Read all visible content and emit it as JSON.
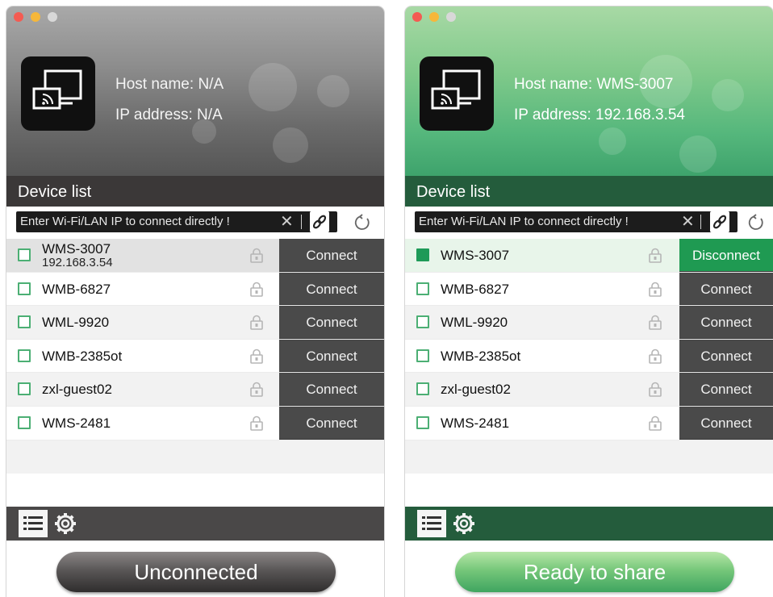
{
  "windows": [
    {
      "id": "left",
      "theme": "gray",
      "host_label": "Host name:",
      "host_value": "N/A",
      "ip_label": "IP address:",
      "ip_value": "N/A",
      "device_list_title": "Device list",
      "ip_placeholder": "Enter Wi-Fi/LAN IP to connect directly !",
      "devices": [
        {
          "name": "WMS-3007",
          "ip": "192.168.3.54",
          "checked": false,
          "button": "Connect"
        },
        {
          "name": "WMB-6827",
          "checked": false,
          "button": "Connect"
        },
        {
          "name": "WML-9920",
          "checked": false,
          "button": "Connect"
        },
        {
          "name": "WMB-2385ot",
          "checked": false,
          "button": "Connect"
        },
        {
          "name": "zxl-guest02",
          "checked": false,
          "button": "Connect"
        },
        {
          "name": "WMS-2481",
          "checked": false,
          "button": "Connect"
        }
      ],
      "status_button": "Unconnected"
    },
    {
      "id": "right",
      "theme": "green",
      "host_label": "Host name:",
      "host_value": "WMS-3007",
      "ip_label": "IP address:",
      "ip_value": "192.168.3.54",
      "device_list_title": "Device list",
      "ip_placeholder": "Enter Wi-Fi/LAN IP to connect directly !",
      "devices": [
        {
          "name": "WMS-3007",
          "checked": true,
          "button": "Disconnect"
        },
        {
          "name": "WMB-6827",
          "checked": false,
          "button": "Connect"
        },
        {
          "name": "WML-9920",
          "checked": false,
          "button": "Connect"
        },
        {
          "name": "WMB-2385ot",
          "checked": false,
          "button": "Connect"
        },
        {
          "name": "zxl-guest02",
          "checked": false,
          "button": "Connect"
        },
        {
          "name": "WMS-2481",
          "checked": false,
          "button": "Connect"
        }
      ],
      "status_button": "Ready to share"
    }
  ],
  "colors": {
    "gray_header": "#6b6b6b",
    "green_header": "#55b77c",
    "connect_button": "#4a4a4a",
    "disconnect_button": "#1f9a52",
    "checkbox_border": "#4caf74"
  },
  "icons": {
    "app_logo": "screen-mirror-icon",
    "clear": "close-icon",
    "link": "link-icon",
    "refresh": "refresh-icon",
    "lock": "lock-icon",
    "list_tab": "list-icon",
    "settings_tab": "gear-icon"
  }
}
